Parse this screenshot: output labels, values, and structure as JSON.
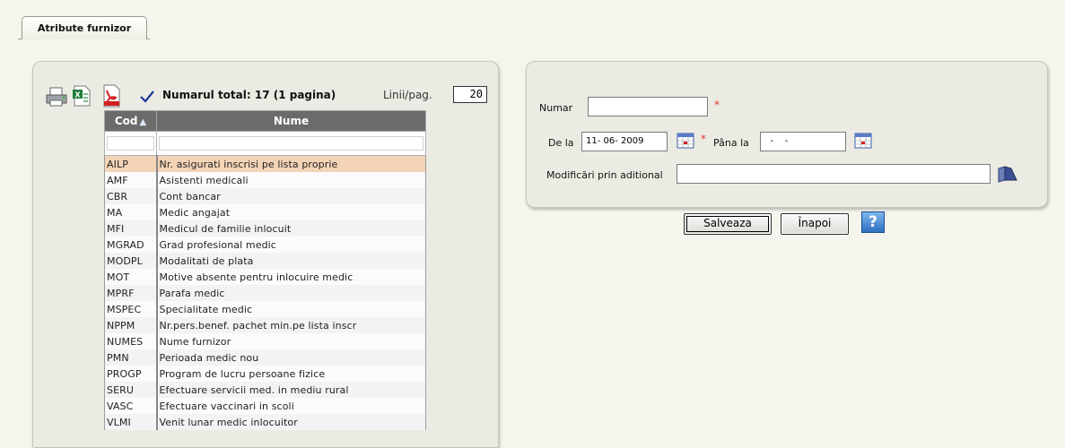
{
  "tab": {
    "label": "Atribute furnizor"
  },
  "toolbar": {
    "icons": [
      "printer-icon",
      "excel-icon",
      "pdf-icon",
      "checkmark-icon"
    ],
    "total_label": "Numarul total: 17 (1 pagina)",
    "rows_per_page_label": "Linii/pag.",
    "rows_per_page_value": "20"
  },
  "grid": {
    "col_code": "Cod",
    "col_name": "Nume",
    "sort_indicator": "▲",
    "rows": [
      {
        "cod": "AILP",
        "nume": "Nr. asigurati inscrisi pe lista proprie"
      },
      {
        "cod": "AMF",
        "nume": "Asistenti medicali"
      },
      {
        "cod": "CBR",
        "nume": "Cont bancar"
      },
      {
        "cod": "MA",
        "nume": "Medic angajat"
      },
      {
        "cod": "MFI",
        "nume": "Medicul de familie inlocuit"
      },
      {
        "cod": "MGRAD",
        "nume": "Grad profesional medic"
      },
      {
        "cod": "MODPL",
        "nume": "Modalitati de plata"
      },
      {
        "cod": "MOT",
        "nume": "Motive absente pentru inlocuire medic"
      },
      {
        "cod": "MPRF",
        "nume": "Parafa medic"
      },
      {
        "cod": "MSPEC",
        "nume": "Specialitate medic"
      },
      {
        "cod": "NPPM",
        "nume": "Nr.pers.benef. pachet min.pe lista inscr"
      },
      {
        "cod": "NUMES",
        "nume": "Nume furnizor"
      },
      {
        "cod": "PMN",
        "nume": "Perioada medic nou"
      },
      {
        "cod": "PROGP",
        "nume": "Program de lucru persoane fizice"
      },
      {
        "cod": "SERU",
        "nume": "Efectuare servicii med. in mediu rural"
      },
      {
        "cod": "VASC",
        "nume": "Efectuare vaccinari in scoli"
      },
      {
        "cod": "VLMI",
        "nume": "Venit lunar medic inlocuitor"
      }
    ]
  },
  "form": {
    "numar_label": "Numar",
    "numar_value": "",
    "required_mark": "*",
    "de_la_label": "De la",
    "de_la_value": "11- 06- 2009",
    "pana_la_label": "Pâna la",
    "pana_la_value": "  -    -",
    "modificari_label": "Modificări prin aditional",
    "modificari_value": ""
  },
  "buttons": {
    "save_label": "Salveaza",
    "back_label": "Înapoi",
    "help_label": "?"
  },
  "colors": {
    "selected_row": "#f3d4b6",
    "header_bg": "#6b6b6b",
    "required": "#e03b2b"
  }
}
